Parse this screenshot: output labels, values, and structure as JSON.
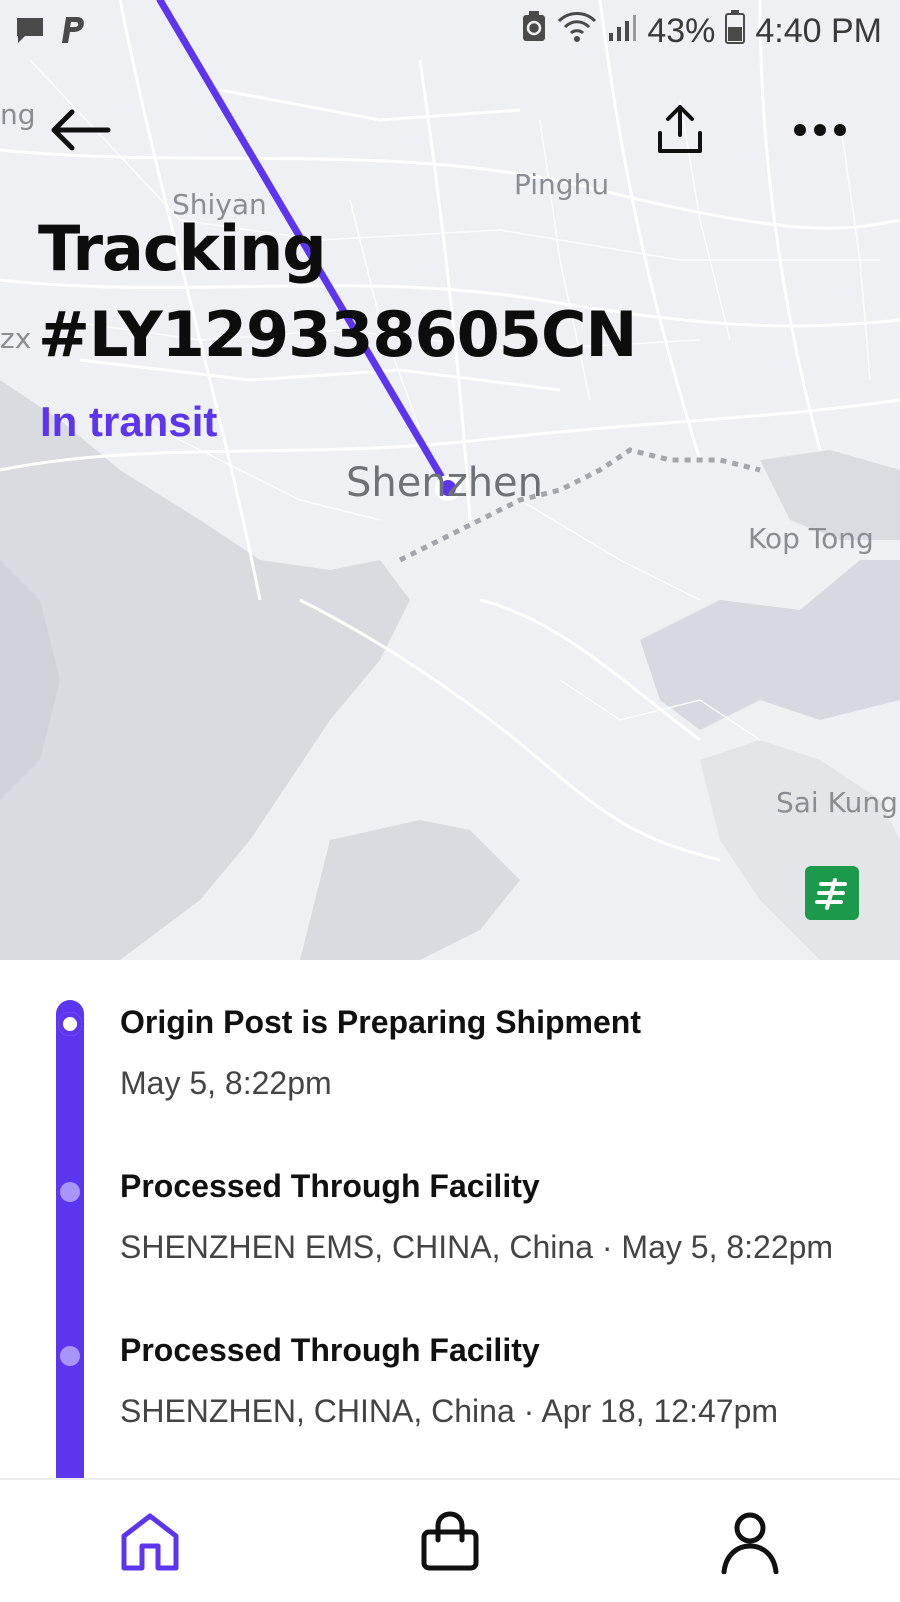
{
  "status_bar": {
    "battery_pct": "43%",
    "time": "4:40 PM"
  },
  "map": {
    "labels": {
      "shiyan": "Shiyan",
      "pinghu": "Pinghu",
      "shenzhen": "Shenzhen",
      "kop_tong": "Kop Tong",
      "sai_kung": "Sai Kung",
      "edge_left_top": "ng",
      "edge_left_mid": "zx"
    }
  },
  "header": {
    "title": "Tracking #LY129338605CN",
    "status": "In transit"
  },
  "colors": {
    "accent": "#5c36ef",
    "carrier_green": "#1a9a4a"
  },
  "timeline": {
    "events": [
      {
        "title": "Origin Post is Preparing Shipment",
        "detail": "May 5, 8:22pm"
      },
      {
        "title": "Processed Through Facility",
        "detail": "SHENZHEN EMS, CHINA, China · May 5, 8:22pm"
      },
      {
        "title": "Processed Through Facility",
        "detail": "SHENZHEN, CHINA, China · Apr 18, 12:47pm"
      }
    ]
  },
  "icons": {
    "back": "arrow-left-icon",
    "share": "share-upload-icon",
    "more": "more-dots-icon",
    "carrier": "china-post-logo-icon",
    "nav_home": "home-icon",
    "nav_shop": "shopping-bag-icon",
    "nav_profile": "profile-icon"
  }
}
